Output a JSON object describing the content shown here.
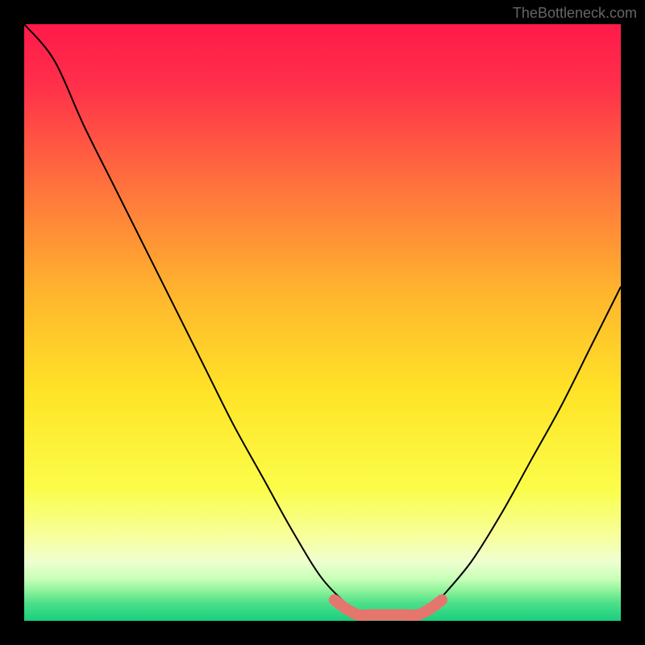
{
  "attribution": "TheBottleneck.com",
  "chart_data": {
    "type": "line",
    "title": "",
    "xlabel": "",
    "ylabel": "",
    "x_range": [
      0,
      100
    ],
    "y_range": [
      0,
      100
    ],
    "series": [
      {
        "name": "bottleneck-curve",
        "x": [
          0,
          5,
          10,
          15,
          20,
          25,
          30,
          35,
          40,
          45,
          50,
          55,
          57,
          60,
          65,
          68,
          70,
          75,
          80,
          85,
          90,
          95,
          100
        ],
        "values": [
          100,
          94,
          83,
          73,
          63,
          53,
          43,
          33,
          24,
          15,
          7,
          2,
          1,
          1,
          1,
          2,
          4,
          10,
          18,
          27,
          36,
          46,
          56
        ]
      }
    ],
    "flat_region": {
      "name": "optimal-range-marker",
      "color": "#e5766e",
      "x": [
        52,
        54,
        56,
        58,
        60,
        62,
        64,
        66,
        68,
        70
      ],
      "values": [
        3.5,
        2.0,
        1.0,
        1.0,
        1.0,
        1.0,
        1.0,
        1.0,
        2.0,
        3.5
      ]
    },
    "background_gradient": {
      "stops": [
        {
          "offset": 0.0,
          "color": "#ff1a4a"
        },
        {
          "offset": 0.1,
          "color": "#ff2f4a"
        },
        {
          "offset": 0.25,
          "color": "#ff6a3f"
        },
        {
          "offset": 0.45,
          "color": "#ffb52e"
        },
        {
          "offset": 0.62,
          "color": "#ffe427"
        },
        {
          "offset": 0.78,
          "color": "#fbfd4a"
        },
        {
          "offset": 0.86,
          "color": "#f7ff9f"
        },
        {
          "offset": 0.9,
          "color": "#efffd0"
        },
        {
          "offset": 0.93,
          "color": "#c7ffb8"
        },
        {
          "offset": 0.95,
          "color": "#8cf29a"
        },
        {
          "offset": 0.97,
          "color": "#4ee08a"
        },
        {
          "offset": 1.0,
          "color": "#18cf7d"
        }
      ]
    }
  }
}
